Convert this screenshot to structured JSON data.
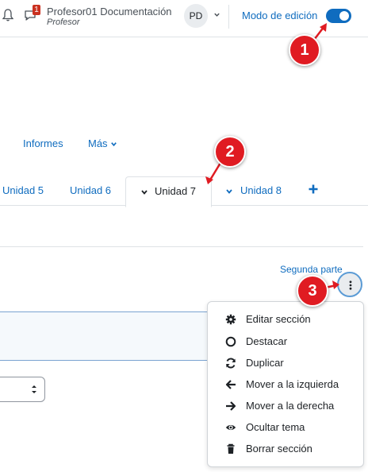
{
  "header": {
    "notifications_icon": "bell-icon",
    "messages_icon": "chat-icon",
    "messages_badge": "1",
    "user_name": "Profesor01 Documentación",
    "user_role": "Profesor",
    "avatar_initials": "PD",
    "edit_mode_label": "Modo de edición",
    "edit_mode_on": true
  },
  "secondary_nav": {
    "reports": "Informes",
    "more": "Más"
  },
  "tabs": {
    "unit5": "Unidad 5",
    "unit6": "Unidad 6",
    "unit7": "Unidad 7",
    "unit8": "Unidad 8",
    "add_icon": "plus-icon"
  },
  "section": {
    "next_link": "Segunda parte"
  },
  "menu": {
    "items": [
      {
        "label": "Editar sección",
        "icon": "gear-icon"
      },
      {
        "label": "Destacar",
        "icon": "circle-icon"
      },
      {
        "label": "Duplicar",
        "icon": "refresh-icon"
      },
      {
        "label": "Mover a la izquierda",
        "icon": "arrow-left-icon"
      },
      {
        "label": "Mover a la derecha",
        "icon": "arrow-right-icon"
      },
      {
        "label": "Ocultar tema",
        "icon": "eye-icon"
      },
      {
        "label": "Borrar sección",
        "icon": "trash-icon"
      }
    ]
  },
  "callouts": [
    "1",
    "2",
    "3"
  ],
  "colors": {
    "link": "#0f6cbf",
    "callout": "#e01b22",
    "badge": "#ca3120"
  }
}
